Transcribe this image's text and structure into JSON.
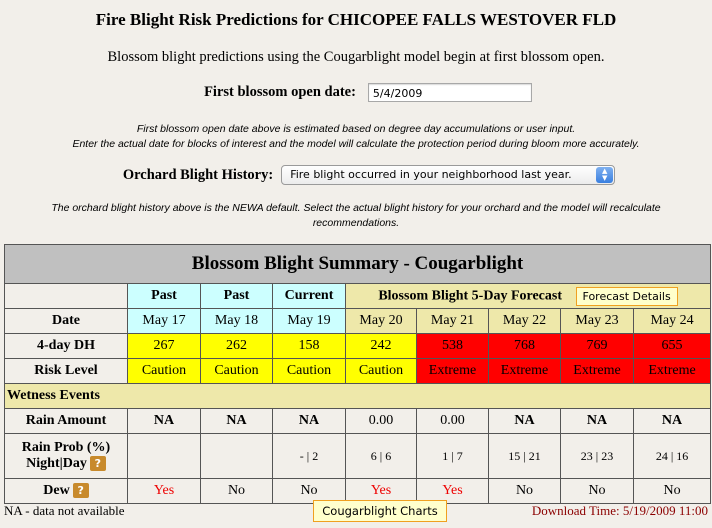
{
  "page": {
    "title": "Fire Blight Risk Predictions for CHICOPEE FALLS WESTOVER FLD",
    "intro": "Blossom blight predictions using the Cougarblight model begin at first blossom open.",
    "first_blossom": {
      "label": "First blossom open date:",
      "value": "5/4/2009"
    },
    "note1_line1": "First blossom open date above is estimated based on degree day accumulations or user input.",
    "note1_line2": "Enter the actual date for blocks of interest and the model will calculate the protection period during bloom more accurately.",
    "history": {
      "label": "Orchard Blight History:",
      "selected": "Fire blight occurred in your neighborhood last year."
    },
    "note2_line1": "The orchard blight history above is the NEWA default. Select the actual blight history for your orchard and the model will recalculate",
    "note2_line2": "recommendations."
  },
  "summary": {
    "caption": "Blossom Blight Summary - Cougarblight",
    "period_headers": [
      "Past",
      "Past",
      "Current"
    ],
    "forecast_header": "Blossom Blight 5-Day Forecast",
    "forecast_details_button": "Forecast Details",
    "row_labels": {
      "date": "Date",
      "dh": "4-day DH",
      "risk": "Risk Level",
      "wetness": "Wetness Events",
      "rain_amount": "Rain Amount",
      "rain_prob_line1": "Rain Prob (%)",
      "rain_prob_line2": "Night|Day",
      "dew": "Dew"
    },
    "dates": [
      "May 17",
      "May 18",
      "May 19",
      "May 20",
      "May 21",
      "May 22",
      "May 23",
      "May 24"
    ],
    "dh": [
      "267",
      "262",
      "158",
      "242",
      "538",
      "768",
      "769",
      "655"
    ],
    "risk": [
      "Caution",
      "Caution",
      "Caution",
      "Caution",
      "Extreme",
      "Extreme",
      "Extreme",
      "Extreme"
    ],
    "rain_amount": [
      "NA",
      "NA",
      "NA",
      "0.00",
      "0.00",
      "NA",
      "NA",
      "NA"
    ],
    "rain_prob": [
      "",
      "",
      "- | 2",
      "6 | 6",
      "1 | 7",
      "15 | 21",
      "23 | 23",
      "24 | 16"
    ],
    "dew": [
      "Yes",
      "No",
      "No",
      "Yes",
      "Yes",
      "No",
      "No",
      "No"
    ],
    "help_icon_glyph": "?",
    "colors": {
      "caution": "#ffff00",
      "extreme": "#ff0000",
      "past": "#ccffff",
      "forecast": "#eee8aa",
      "dew_yes": "#ee0000"
    }
  },
  "footer": {
    "na_note": "NA - data not available",
    "charts_button": "Cougarblight Charts",
    "download_time": "Download Time: 5/19/2009 11:00"
  }
}
